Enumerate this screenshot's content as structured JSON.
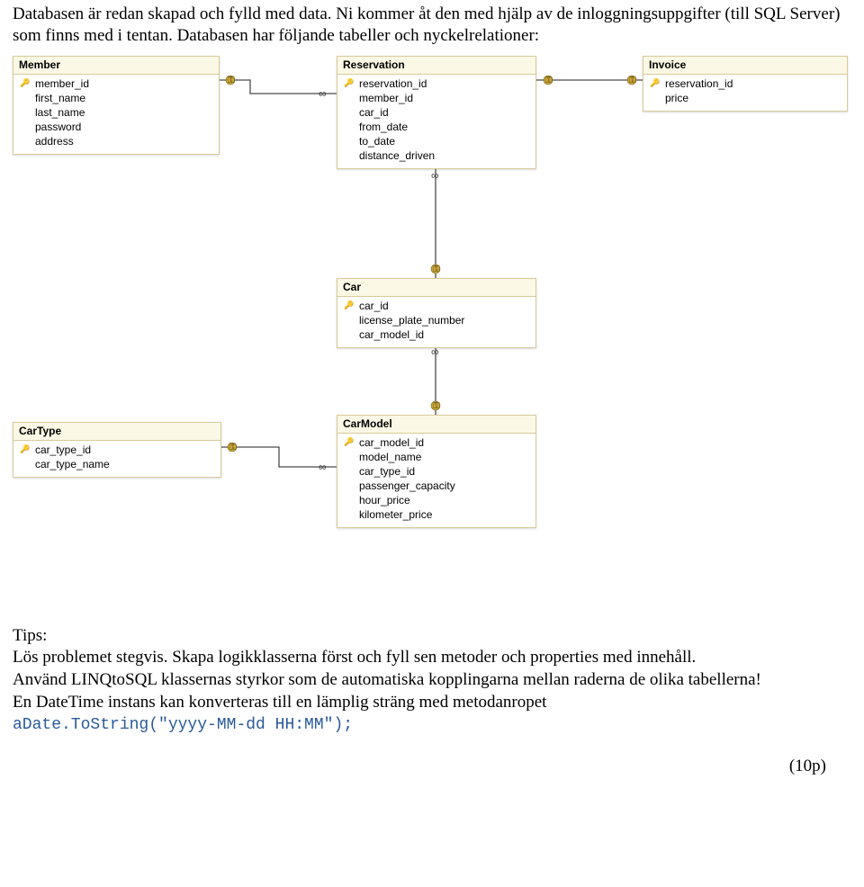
{
  "intro": {
    "p1": "Databasen är redan skapad och fylld med data. Ni kommer åt den med hjälp av de inloggningsuppgifter (till SQL Server) som finns med i tentan. Databasen har följande tabeller och nyckelrelationer:"
  },
  "tables": {
    "member": {
      "title": "Member",
      "cols": [
        {
          "pk": true,
          "name": "member_id"
        },
        {
          "pk": false,
          "name": "first_name"
        },
        {
          "pk": false,
          "name": "last_name"
        },
        {
          "pk": false,
          "name": "password"
        },
        {
          "pk": false,
          "name": "address"
        }
      ]
    },
    "reservation": {
      "title": "Reservation",
      "cols": [
        {
          "pk": true,
          "name": "reservation_id"
        },
        {
          "pk": false,
          "name": "member_id"
        },
        {
          "pk": false,
          "name": "car_id"
        },
        {
          "pk": false,
          "name": "from_date"
        },
        {
          "pk": false,
          "name": "to_date"
        },
        {
          "pk": false,
          "name": "distance_driven"
        }
      ]
    },
    "invoice": {
      "title": "Invoice",
      "cols": [
        {
          "pk": true,
          "name": "reservation_id"
        },
        {
          "pk": false,
          "name": "price"
        }
      ]
    },
    "car": {
      "title": "Car",
      "cols": [
        {
          "pk": true,
          "name": "car_id"
        },
        {
          "pk": false,
          "name": "license_plate_number"
        },
        {
          "pk": false,
          "name": "car_model_id"
        }
      ]
    },
    "carmodel": {
      "title": "CarModel",
      "cols": [
        {
          "pk": true,
          "name": "car_model_id"
        },
        {
          "pk": false,
          "name": "model_name"
        },
        {
          "pk": false,
          "name": "car_type_id"
        },
        {
          "pk": false,
          "name": "passenger_capacity"
        },
        {
          "pk": false,
          "name": "hour_price"
        },
        {
          "pk": false,
          "name": "kilometer_price"
        }
      ]
    },
    "cartype": {
      "title": "CarType",
      "cols": [
        {
          "pk": true,
          "name": "car_type_id"
        },
        {
          "pk": false,
          "name": "car_type_name"
        }
      ]
    }
  },
  "tips": {
    "heading": "Tips:",
    "line1": "Lös problemet stegvis. Skapa logikklasserna först och fyll sen metoder och properties med innehåll.",
    "line2": "Använd LINQtoSQL klassernas styrkor som de automatiska kopplingarna mellan raderna de olika tabellerna!",
    "line3a": "En DateTime instans kan konverteras till en lämplig sträng med metodanropet ",
    "code": "aDate.ToString(\"yyyy-MM-dd HH:MM\");"
  },
  "points": "(10p)"
}
